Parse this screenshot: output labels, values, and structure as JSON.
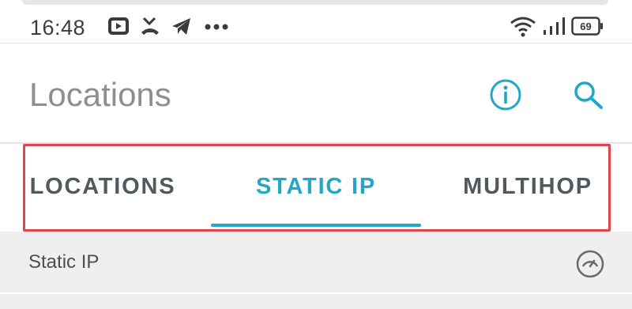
{
  "status_bar": {
    "time": "16:48",
    "left_icons": [
      "youtube-icon",
      "missed-call-icon",
      "telegram-icon",
      "more-dots-icon"
    ],
    "right_icons": [
      "wifi-icon",
      "signal-icon",
      "battery-icon"
    ],
    "battery_level": "69"
  },
  "app_bar": {
    "title": "Locations",
    "actions": [
      "info-icon",
      "search-icon"
    ],
    "accent_color": "#23a6c7"
  },
  "tabs": [
    {
      "label": "LOCATIONS",
      "active": false
    },
    {
      "label": "STATIC IP",
      "active": true
    },
    {
      "label": "MULTIHOP",
      "active": false
    }
  ],
  "highlight_color": "#e0454e",
  "section": {
    "label": "Static IP",
    "icon": "speedometer-icon"
  }
}
